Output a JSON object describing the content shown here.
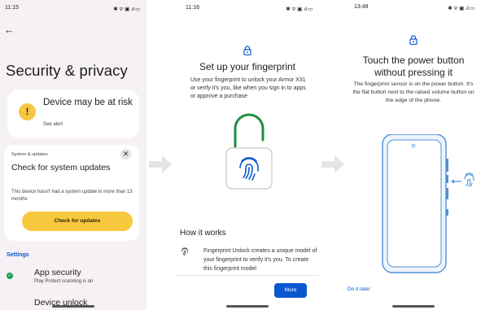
{
  "screen1": {
    "status_time": "11:15",
    "status_icons": "✱ ᯤ ▣ .ıl ▭",
    "title": "Security & privacy",
    "alert": {
      "title": "Device may be at risk",
      "subtitle": "See alert",
      "icon": "warning-icon"
    },
    "update_card": {
      "label": "System & updates",
      "title": "Check for system updates",
      "text": "This device hasn't had a system update in more than 13 months",
      "button": "Check for updates"
    },
    "settings_label": "Settings",
    "app_security": {
      "title": "App security",
      "subtitle": "Play Protect scanning is on"
    },
    "device_unlock": "Device unlock"
  },
  "screen2": {
    "status_time": "11:16",
    "status_icons": "✱ ᯤ ▣ .ıl ▭",
    "title": "Set up your fingerprint",
    "description": "Use your fingerprint to unlock your Armor X31 or verify it's you, like when you sign in to apps or approve a purchase",
    "how_it_works_title": "How it works",
    "how_it_works_text": "Fingerprint Unlock creates a unique model of your fingerprint to verify it's you. To create this fingerprint model",
    "more_button": "More"
  },
  "screen3": {
    "status_time": "13:48",
    "status_icons": "✱ ᯤ ▣ .ıl ▭",
    "title": "Touch the power button without pressing it",
    "description": "The fingerprint sensor is on the power button. It's the flat button next to the raised volume button on the edge of the phone.",
    "do_it_later": "Do it later"
  },
  "colors": {
    "accent_blue": "#0b57d0",
    "warning_yellow": "#f6c744",
    "button_yellow": "#f8c83f",
    "success_green": "#1e9e51",
    "lock_green": "#1e8e3e",
    "illustration_blue": "#4f8fd6"
  }
}
